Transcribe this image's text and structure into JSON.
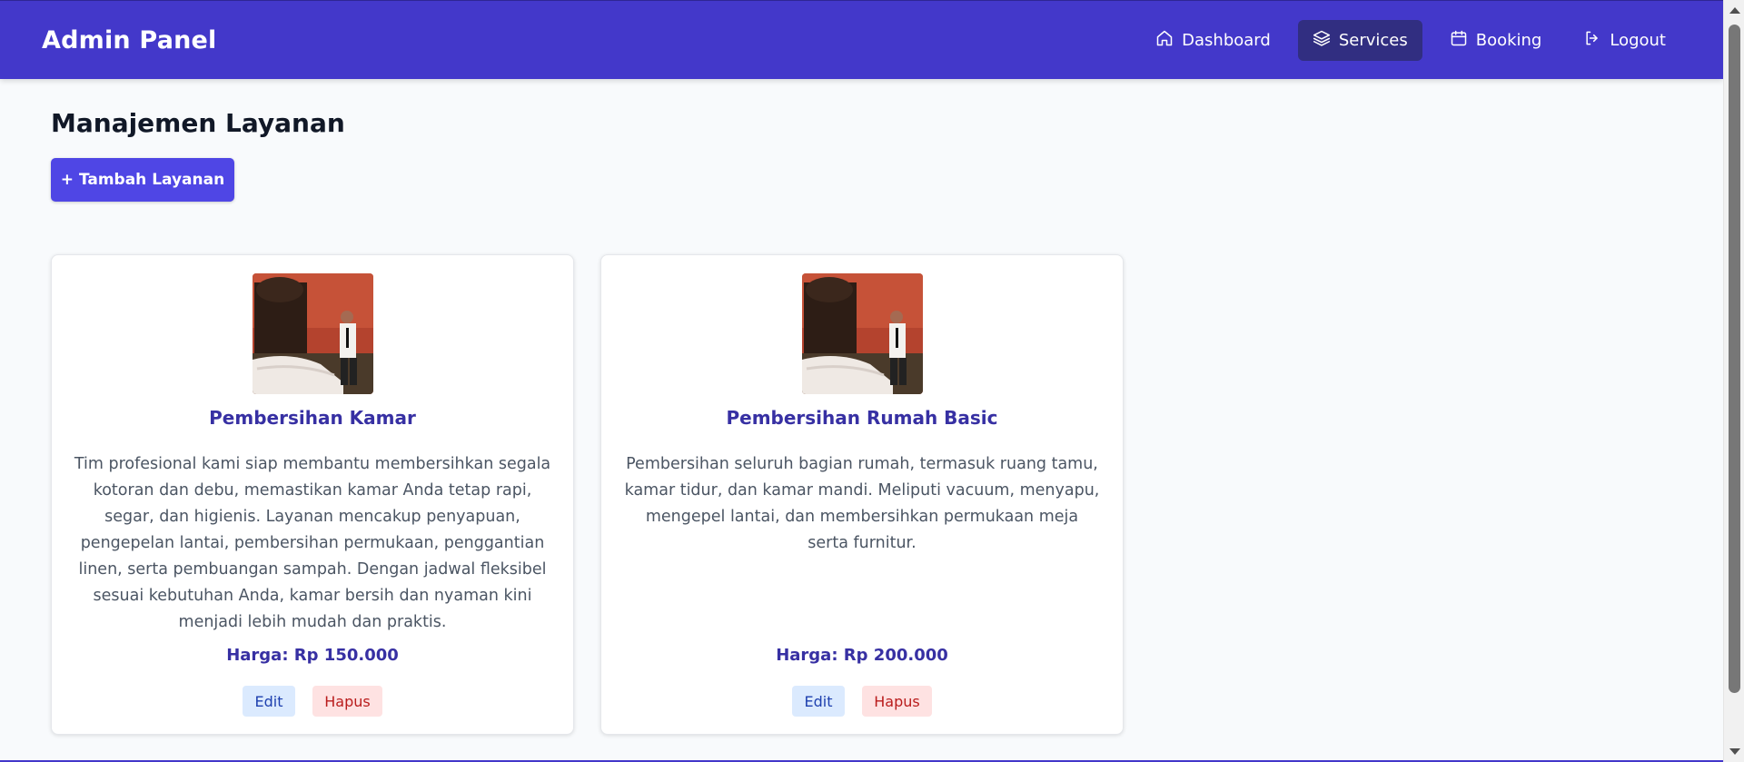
{
  "header": {
    "brand": "Admin Panel",
    "nav": [
      {
        "label": "Dashboard",
        "icon": "home-icon",
        "active": false
      },
      {
        "label": "Services",
        "icon": "layers-icon",
        "active": true
      },
      {
        "label": "Booking",
        "icon": "calendar-icon",
        "active": false
      },
      {
        "label": "Logout",
        "icon": "logout-icon",
        "active": false
      }
    ]
  },
  "main": {
    "title": "Manajemen Layanan",
    "add_button": "+ Tambah Layanan"
  },
  "services": [
    {
      "title": "Pembersihan Kamar",
      "description": "Tim profesional kami siap membantu membersihkan segala kotoran dan debu, memastikan kamar Anda tetap rapi, segar, dan higienis. Layanan mencakup penyapuan, pengepelan lantai, pembersihan permukaan, penggantian linen, serta pembuangan sampah. Dengan jadwal fleksibel sesuai kebutuhan Anda, kamar bersih dan nyaman kini menjadi lebih mudah dan praktis.",
      "price": "Harga: Rp 150.000",
      "edit_label": "Edit",
      "delete_label": "Hapus"
    },
    {
      "title": "Pembersihan Rumah Basic",
      "description": "Pembersihan seluruh bagian rumah, termasuk ruang tamu, kamar tidur, dan kamar mandi. Meliputi vacuum, menyapu, mengepel lantai, dan membersihkan permukaan meja serta furnitur.",
      "price": "Harga: Rp 200.000",
      "edit_label": "Edit",
      "delete_label": "Hapus"
    }
  ],
  "colors": {
    "header_bg": "#4338ca",
    "active_nav_bg": "#312e81",
    "primary_button": "#4f46e5",
    "card_title": "#3730a3",
    "edit_bg": "#dbeafe",
    "delete_bg": "#fee2e2"
  }
}
